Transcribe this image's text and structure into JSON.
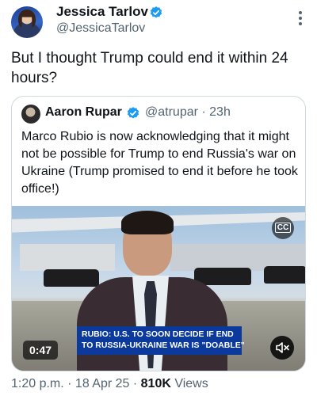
{
  "tweet": {
    "author_name": "Jessica Tarlov",
    "author_handle": "@JessicaTarlov",
    "text": "But I thought Trump could end it within 24 hours?",
    "timestamp": "1:20 p.m. · 18 Apr 25",
    "separator": " · ",
    "views_count": "810K",
    "views_label": " Views"
  },
  "quoted": {
    "author_name": "Aaron Rupar",
    "author_handle": "@atrupar",
    "time": " · 23h",
    "text": "Marco Rubio is now acknowledging that it might not be possible for Trump to end Russia's war on Ukraine (Trump promised to end it before he took office!)",
    "video": {
      "duration": "0:47",
      "caption_button": "CC",
      "lower_third_line1": "RUBIO: U.S. TO SOON DECIDE IF END",
      "lower_third_line2": "TO RUSSIA-UKRAINE WAR IS \"DOABLE\""
    }
  },
  "colors": {
    "verified": "#1d9bf0",
    "secondary_text": "#536471",
    "lower_third": "#0b3a9c"
  },
  "icons": [
    "verified-badge-icon",
    "more-options-icon",
    "closed-captions-icon",
    "muted-speaker-icon"
  ]
}
